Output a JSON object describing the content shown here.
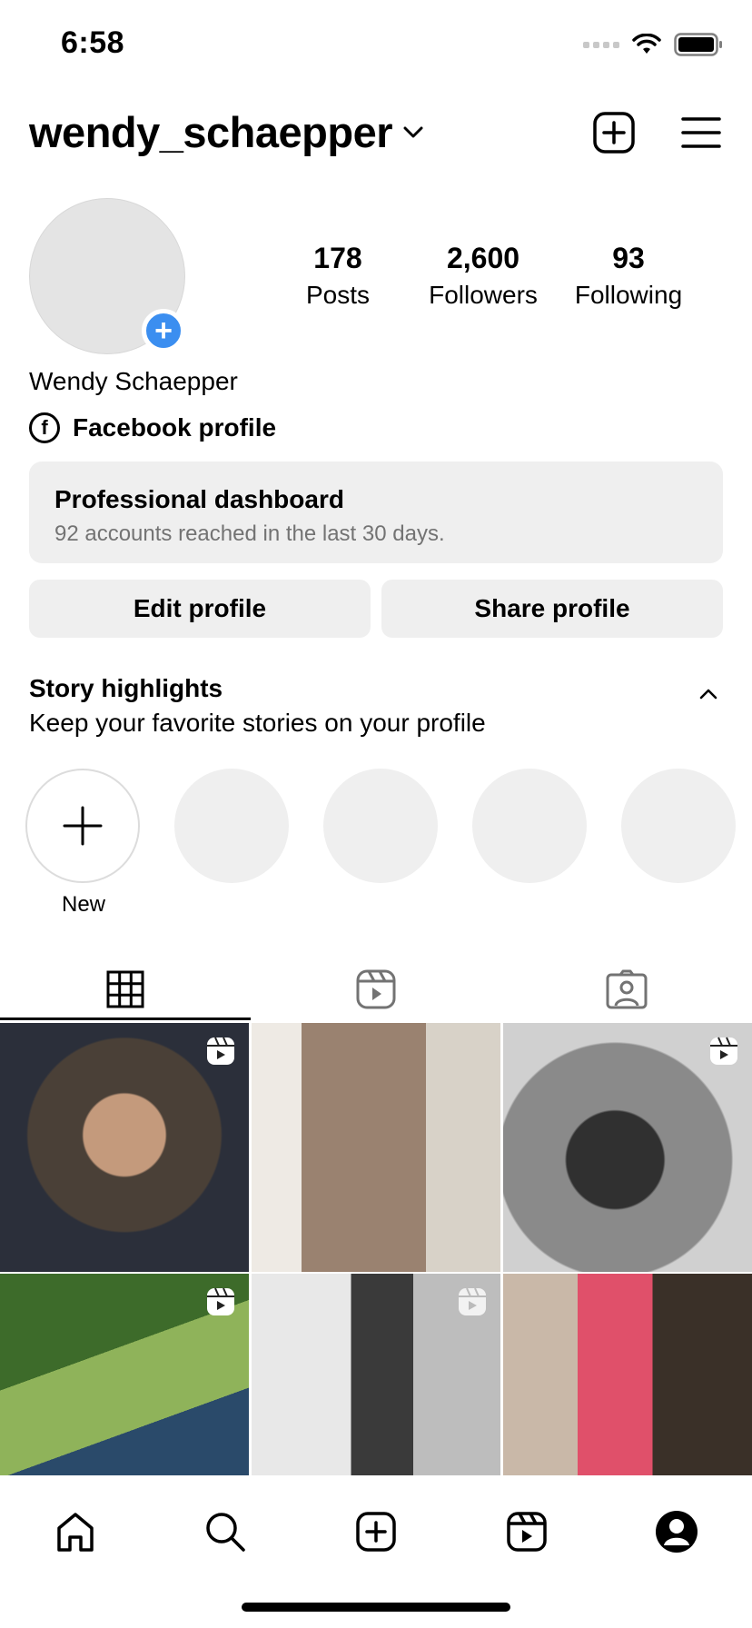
{
  "status_bar": {
    "time": "6:58"
  },
  "header": {
    "username": "wendy_schaepper",
    "icons": [
      "chevron-down-icon",
      "create-post-icon",
      "menu-icon"
    ]
  },
  "profile": {
    "full_name": "Wendy Schaepper",
    "stats": [
      {
        "value": "178",
        "label": "Posts"
      },
      {
        "value": "2,600",
        "label": "Followers"
      },
      {
        "value": "93",
        "label": "Following"
      }
    ],
    "facebook_link": "Facebook profile"
  },
  "dashboard": {
    "title": "Professional dashboard",
    "subtitle": "92 accounts reached in the last 30 days."
  },
  "buttons": {
    "edit": "Edit profile",
    "share": "Share profile"
  },
  "highlights": {
    "title": "Story highlights",
    "subtitle": "Keep your favorite stories on your profile",
    "new_label": "New"
  },
  "tabs": [
    "grid-icon",
    "reels-icon",
    "tagged-icon"
  ],
  "grid": [
    {
      "kind": "reel",
      "colors": [
        "#4a4037",
        "#2b2f3a",
        "#c49a7c"
      ]
    },
    {
      "kind": "photo",
      "colors": [
        "#d8d2c8",
        "#9a8270",
        "#eeeae4"
      ]
    },
    {
      "kind": "reel",
      "colors": [
        "#8a8a8a",
        "#303030",
        "#d0d0d0"
      ]
    },
    {
      "kind": "reel",
      "colors": [
        "#3d6b2a",
        "#8fb35a",
        "#2a4a6a"
      ]
    },
    {
      "kind": "reel",
      "colors": [
        "#e8e8e8",
        "#3a3a3a",
        "#bdbdbd"
      ]
    },
    {
      "kind": "photo",
      "colors": [
        "#c9b8a8",
        "#e0506a",
        "#3a3028"
      ]
    }
  ],
  "bottom_nav": [
    "home-icon",
    "search-icon",
    "create-icon",
    "reels-icon",
    "profile-icon"
  ]
}
